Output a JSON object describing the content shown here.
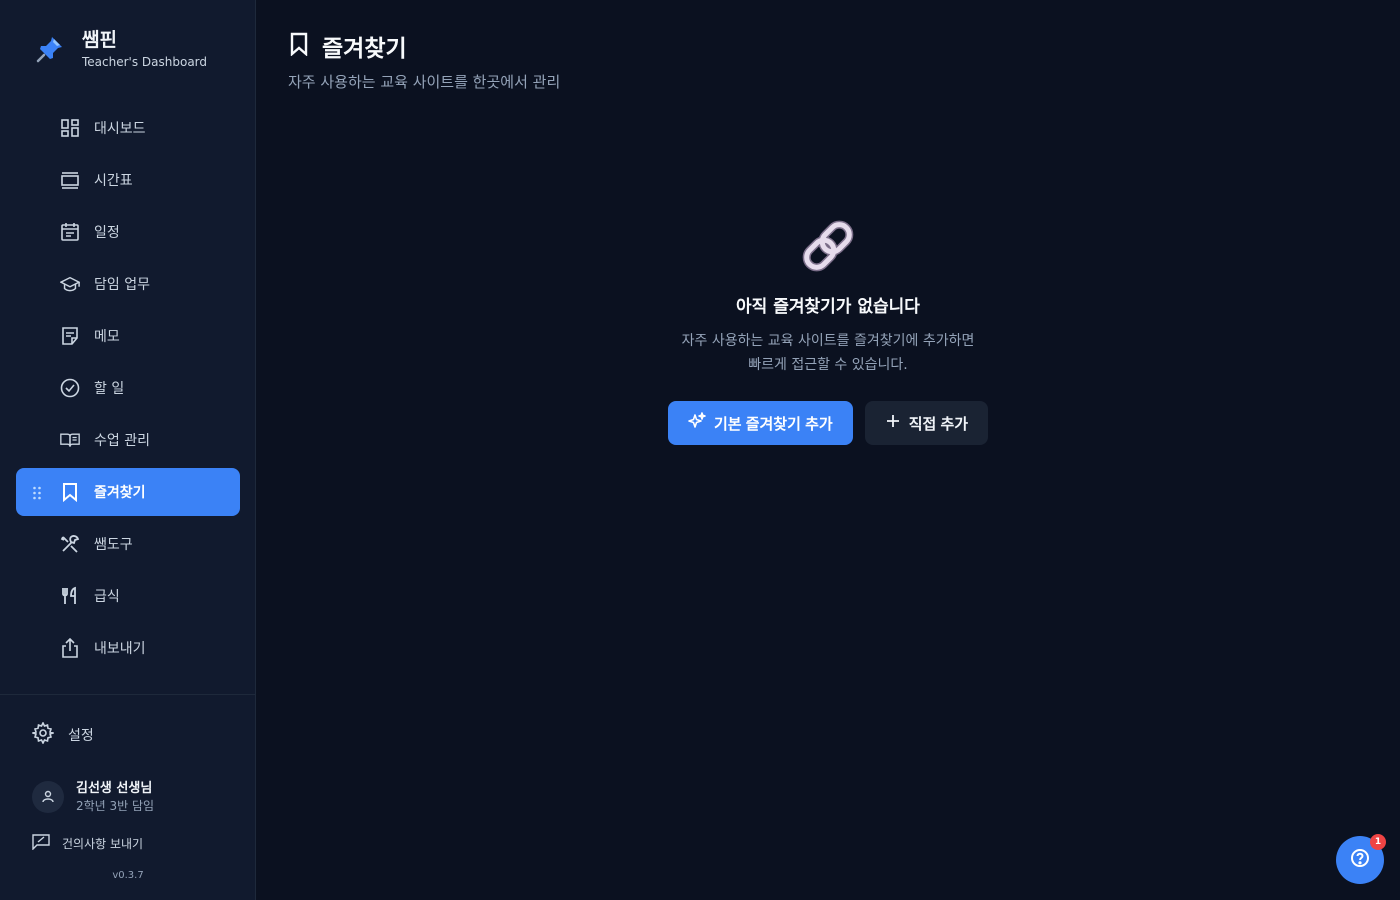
{
  "brand": {
    "title": "쌤핀",
    "subtitle": "Teacher's Dashboard",
    "logo_icon": "pushpin-icon"
  },
  "sidebar": {
    "items": [
      {
        "label": "대시보드",
        "icon": "dashboard-grid-icon"
      },
      {
        "label": "시간표",
        "icon": "timetable-icon"
      },
      {
        "label": "일정",
        "icon": "calendar-icon"
      },
      {
        "label": "담임 업무",
        "icon": "graduation-cap-icon"
      },
      {
        "label": "메모",
        "icon": "memo-icon"
      },
      {
        "label": "할 일",
        "icon": "check-circle-icon"
      },
      {
        "label": "수업 관리",
        "icon": "book-open-icon"
      },
      {
        "label": "즐겨찾기",
        "icon": "bookmark-icon",
        "active": true
      },
      {
        "label": "쌤도구",
        "icon": "tools-icon"
      },
      {
        "label": "급식",
        "icon": "utensils-icon"
      },
      {
        "label": "내보내기",
        "icon": "share-icon"
      }
    ],
    "settings_label": "설정",
    "profile": {
      "name": "김선생 선생님",
      "role": "2학년 3반 담임"
    },
    "feedback_label": "건의사항 보내기",
    "version": "v0.3.7"
  },
  "page": {
    "title": "즐겨찾기",
    "subtitle": "자주 사용하는 교육 사이트를 한곳에서 관리"
  },
  "empty_state": {
    "icon": "link-chain-icon",
    "title": "아직 즐겨찾기가 없습니다",
    "desc_line1": "자주 사용하는 교육 사이트를 즐겨찾기에 추가하면",
    "desc_line2": "빠르게 접근할 수 있습니다.",
    "primary_button": "기본 즐겨찾기 추가",
    "secondary_button": "직접 추가"
  },
  "help": {
    "badge_count": "1"
  },
  "colors": {
    "accent": "#3b82f6",
    "background": "#0b1120",
    "sidebar": "#111a2e",
    "badge": "#ef4444"
  }
}
